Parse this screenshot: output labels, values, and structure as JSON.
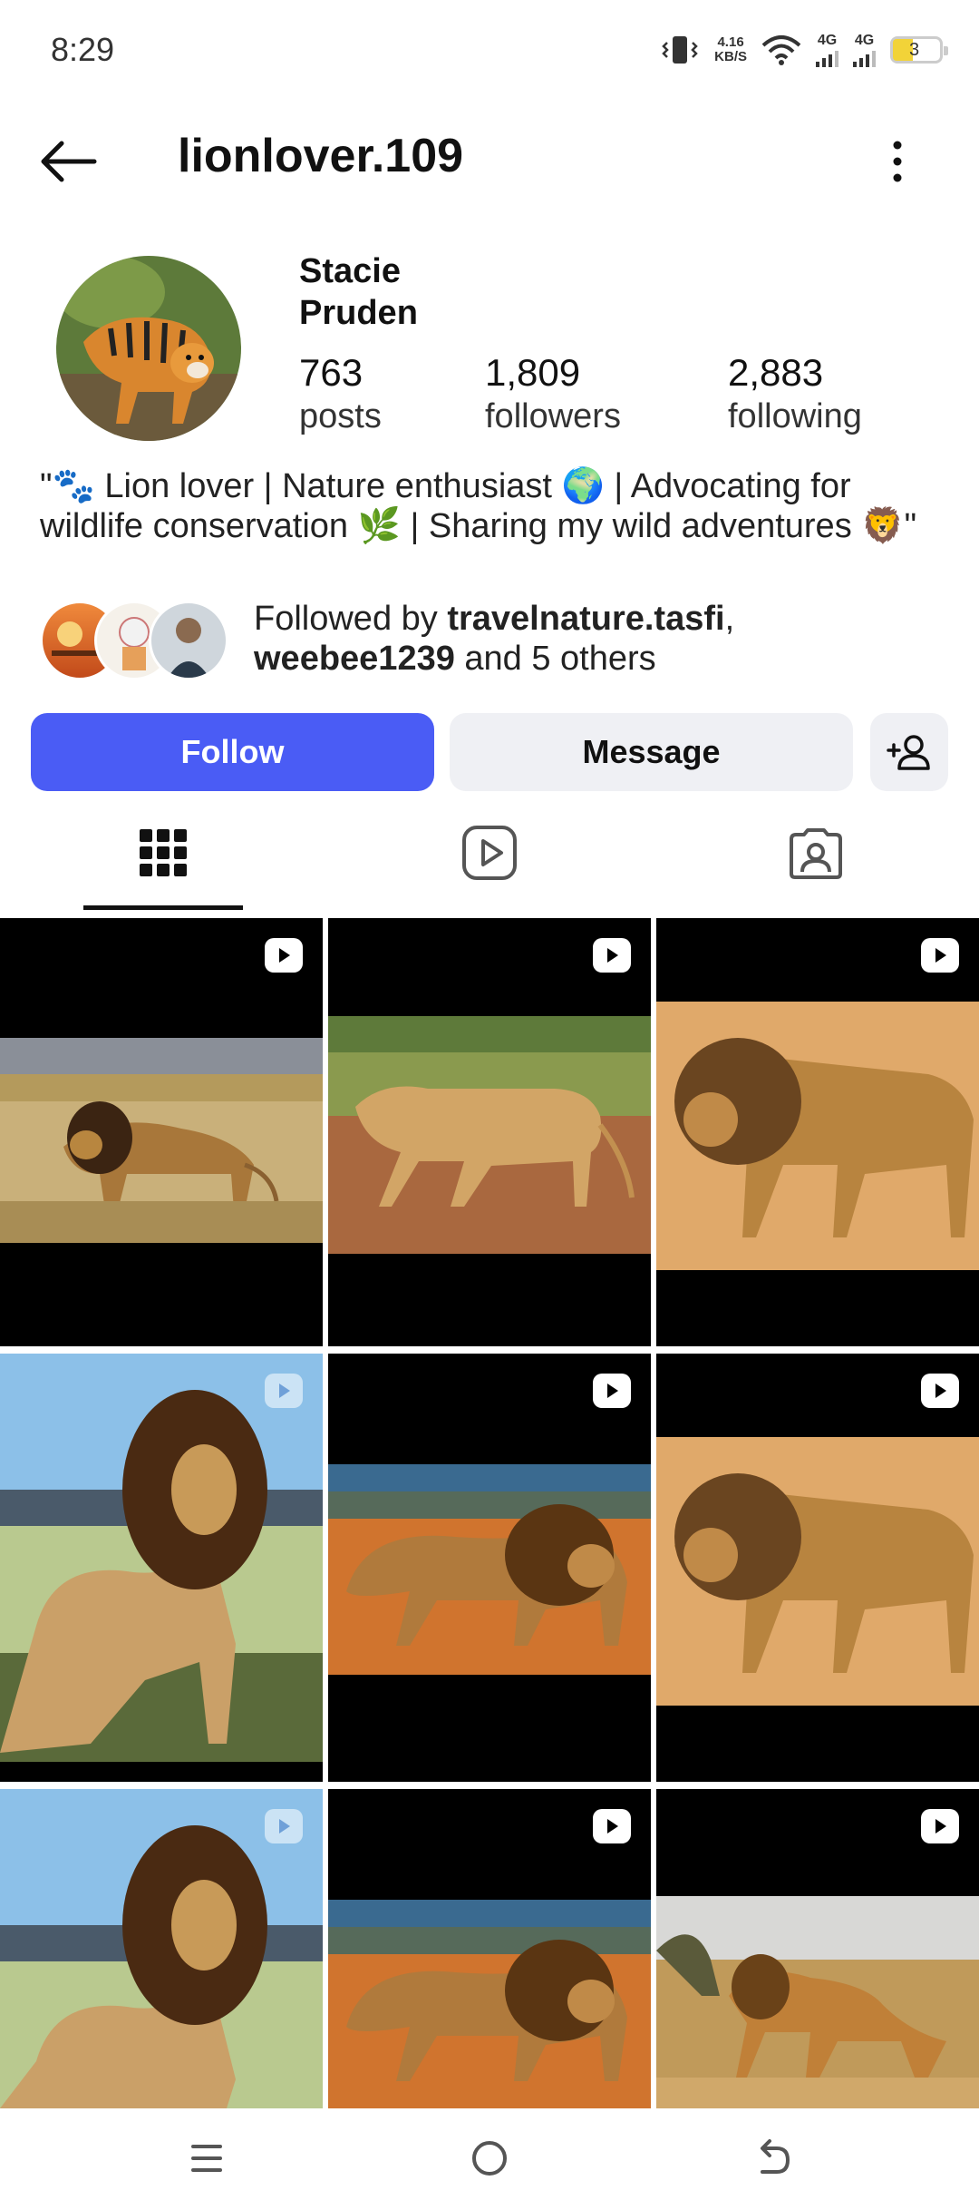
{
  "status_bar": {
    "time": "8:29",
    "net_speed_top": "4.16",
    "net_speed_bottom": "KB/S",
    "sim1": "4G",
    "sim2": "4G",
    "battery": "3"
  },
  "header": {
    "username": "lionlover.109"
  },
  "profile": {
    "full_name_line1": "Stacie",
    "full_name_line2": "Pruden",
    "stats": [
      {
        "value": "763",
        "label": "posts"
      },
      {
        "value": "1,809",
        "label": "followers"
      },
      {
        "value": "2,883",
        "label": "following"
      }
    ],
    "bio": "\"🐾 Lion lover | Nature enthusiast 🌍 | Advocating for wildlife conservation 🌿 | Sharing my wild adventures 🦁\"",
    "followed_by_prefix": "Followed by ",
    "followed_by_user1": "travelnature.tasfi",
    "followed_by_sep": ",",
    "followed_by_user2": "weebee1239",
    "followed_by_suffix": " and 5 others"
  },
  "actions": {
    "follow_label": "Follow",
    "message_label": "Message"
  },
  "colors": {
    "follow_button": "#4a5cf5",
    "secondary_button": "#eff0f4"
  }
}
